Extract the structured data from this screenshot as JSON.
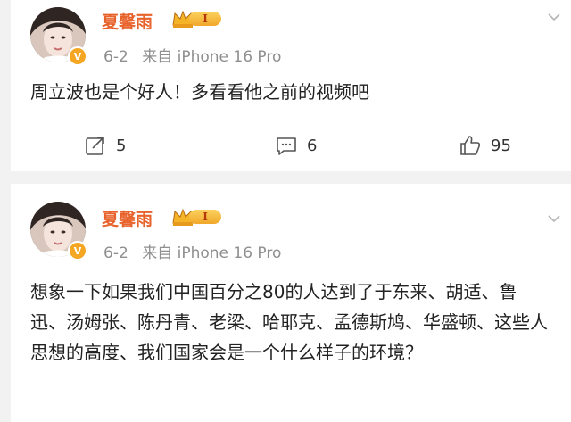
{
  "posts": [
    {
      "username": "夏馨雨",
      "level": "I",
      "date": "6-2",
      "source": "来自 iPhone 16 Pro",
      "content": "周立波也是个好人！多看看他之前的视频吧",
      "reposts": "5",
      "comments": "6",
      "likes": "95"
    },
    {
      "username": "夏馨雨",
      "level": "I",
      "date": "6-2",
      "source": "来自 iPhone 16 Pro",
      "content": "想象一下如果我们中国百分之80的人达到了于东来、胡适、鲁迅、汤姆张、陈丹青、老梁、哈耶克、孟德斯鸠、华盛顿、这些人思想的高度、我们国家会是一个什么样子的环境？"
    }
  ],
  "colors": {
    "username": "#e8632b",
    "meta": "#8f8f8f",
    "background": "#f2f2f2"
  },
  "icons": [
    "avatar",
    "vip-crown-icon",
    "verified-badge-icon",
    "chevron-down-icon",
    "repost-icon",
    "comment-icon",
    "like-icon"
  ]
}
